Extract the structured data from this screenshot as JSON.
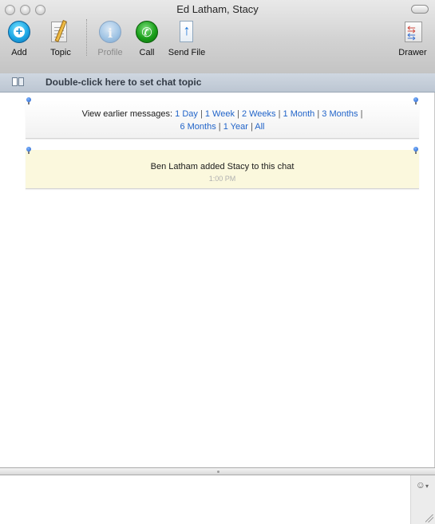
{
  "window": {
    "title": "Ed Latham, Stacy"
  },
  "toolbar": {
    "add": {
      "label": "Add",
      "icon": "add-contact-icon"
    },
    "topic": {
      "label": "Topic",
      "icon": "topic-notepad-icon"
    },
    "profile": {
      "label": "Profile",
      "icon": "info-icon",
      "enabled": false
    },
    "call": {
      "label": "Call",
      "icon": "phone-icon"
    },
    "send_file": {
      "label": "Send File",
      "icon": "send-file-icon"
    },
    "drawer": {
      "label": "Drawer",
      "icon": "drawer-icon"
    }
  },
  "topic_bar": {
    "text": "Double-click here to set chat topic"
  },
  "earlier_messages": {
    "prefix": "View earlier messages:",
    "links": [
      "1 Day",
      "1 Week",
      "2 Weeks",
      "1 Month",
      "3 Months",
      "6 Months",
      "1 Year",
      "All"
    ]
  },
  "system_message": {
    "text": "Ben Latham added Stacy to this chat",
    "time": "1:00 PM"
  },
  "input": {
    "value": "",
    "emoticon_icon": "smiley-icon"
  },
  "colors": {
    "link": "#2164c9",
    "system_notice_bg": "#fbf8dd",
    "topic_bar_bg": "#c6cfda"
  }
}
